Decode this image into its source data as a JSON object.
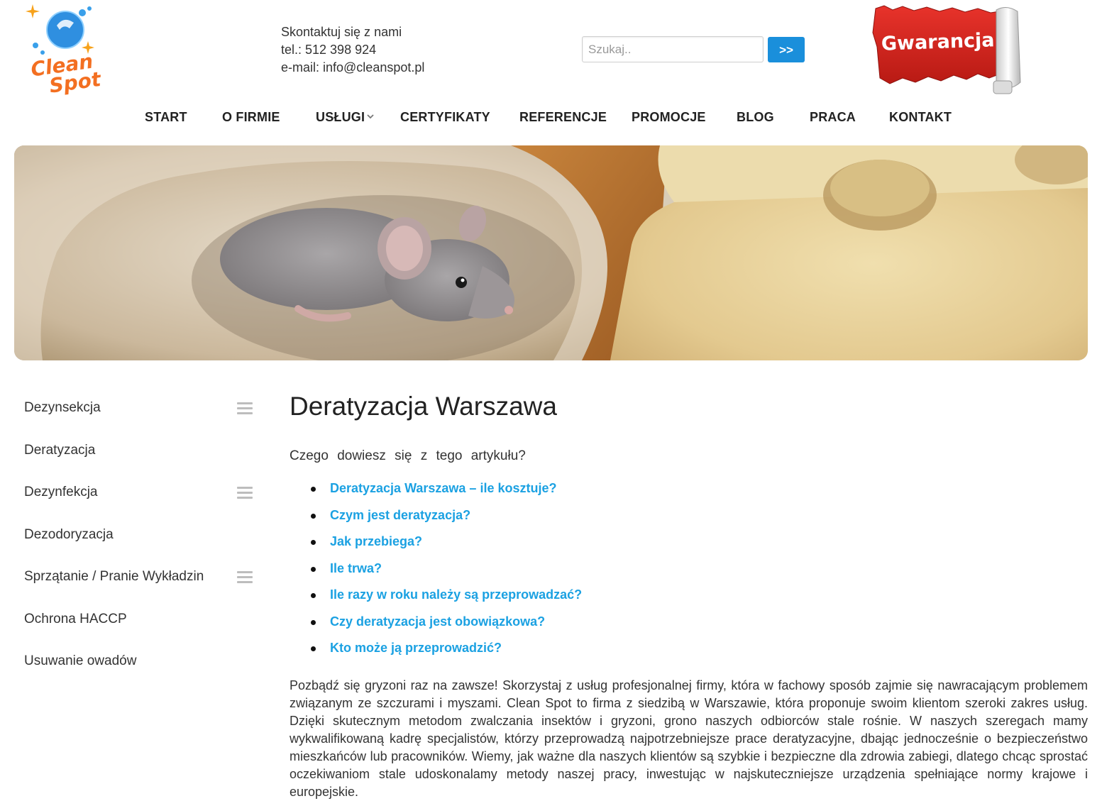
{
  "header": {
    "logo": {
      "line1": "Clean",
      "line2": "Spot"
    },
    "contact": {
      "heading": "Skontaktuj się z nami",
      "phone": "tel.: 512 398 924",
      "email": "e-mail: info@cleanspot.pl"
    },
    "search": {
      "placeholder": "Szukaj..",
      "button_label": ">>"
    },
    "guarantee_label": "Gwarancja"
  },
  "nav": {
    "items": [
      {
        "label": "START"
      },
      {
        "label": "O FIRMIE"
      },
      {
        "label": "USŁUGI",
        "has_dropdown": true
      },
      {
        "label": "CERTYFIKATY"
      },
      {
        "label": "REFERENCJE"
      },
      {
        "label": "PROMOCJE"
      },
      {
        "label": "BLOG"
      },
      {
        "label": "PRACA"
      },
      {
        "label": "KONTAKT"
      }
    ]
  },
  "sidebar": {
    "items": [
      {
        "label": "Dezynsekcja",
        "has_submenu": true
      },
      {
        "label": "Deratyzacja",
        "has_submenu": false
      },
      {
        "label": "Dezynfekcja",
        "has_submenu": true
      },
      {
        "label": "Dezodoryzacja",
        "has_submenu": false
      },
      {
        "label": "Sprzątanie / Pranie Wykładzin",
        "has_submenu": true
      },
      {
        "label": "Ochrona HACCP",
        "has_submenu": false
      },
      {
        "label": "Usuwanie owadów",
        "has_submenu": false
      }
    ]
  },
  "main": {
    "title": "Deratyzacja Warszawa",
    "intro": "Czego dowiesz się z tego artykułu?",
    "toc": [
      "Deratyzacja Warszawa – ile kosztuje?",
      "Czym jest deratyzacja?",
      "Jak przebiega?",
      "Ile trwa?",
      "Ile razy w roku należy są przeprowadzać?",
      "Czy deratyzacja jest obowiązkowa?",
      "Kto może ją przeprowadzić?"
    ],
    "paragraph": "Pozbądź się gryzoni raz na zawsze! Skorzystaj z usług profesjonalnej firmy, która w fachowy sposób zajmie się nawracającym problemem związanym ze szczurami i myszami. Clean Spot to firma z siedzibą w Warszawie, która proponuje swoim klientom szeroki zakres usług. Dzięki skutecznym metodom zwalczania insektów i gryzoni, grono naszych odbiorców stale rośnie. W naszych szeregach mamy wykwalifikowaną kadrę specjalistów, którzy przeprowadzą najpotrzebniejsze prace deratyzacyjne, dbając jednocześnie o bezpieczeństwo mieszkańców lub pracowników. Wiemy, jak ważne dla naszych klientów są szybkie i bezpieczne dla zdrowia zabiegi, dlatego chcąc sprostać oczekiwaniom stale udoskonalamy metody naszej pracy, inwestując w najskuteczniejsze urządzenia spełniające normy krajowe i europejskie."
  },
  "colors": {
    "link": "#1ba1e2",
    "search_button": "#1a8fdb",
    "guarantee_red": "#d9231d"
  }
}
